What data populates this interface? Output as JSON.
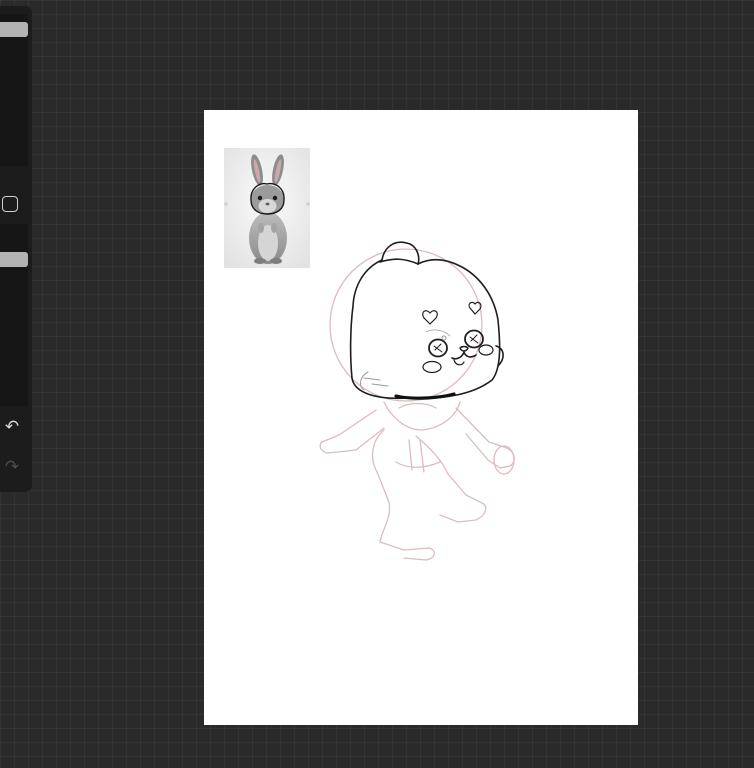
{
  "app": {
    "canvas_title": "",
    "background_color": "#2a2a2a",
    "canvas_color": "#ffffff"
  },
  "toolbar": {
    "brush_size_value": 0.94,
    "opacity_value": 0.83,
    "modify_icon": "square-outline-icon",
    "undo_icon": "undo-icon",
    "undo_glyph": "↶",
    "redo_icon": "redo-icon",
    "redo_glyph": "↷"
  },
  "reference": {
    "subject_icon": "rabbit-photo"
  },
  "sketch": {
    "line_color": "#1e1e1e",
    "construction_color": "#d9b8bb"
  }
}
